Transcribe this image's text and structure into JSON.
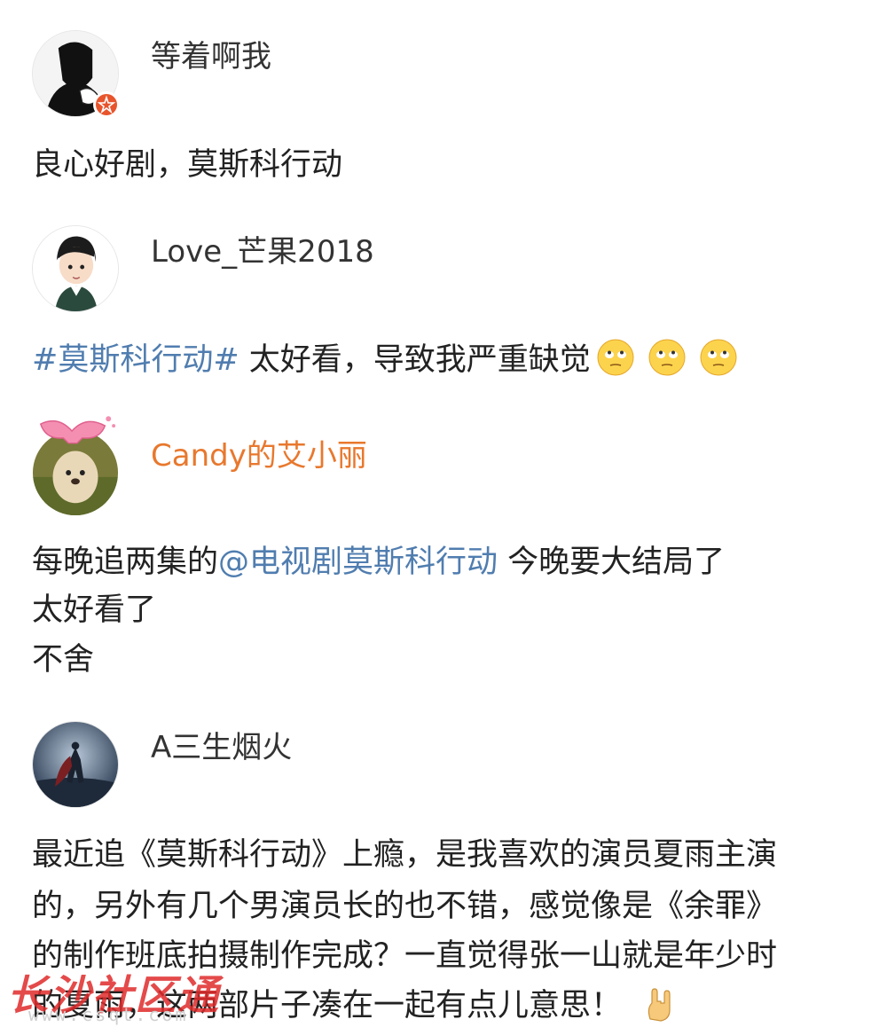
{
  "posts": [
    {
      "username": "等着啊我",
      "lines": [
        "良心好剧，莫斯科行动"
      ]
    },
    {
      "username": "Love_芒果2018",
      "hashtag": "#莫斯科行动#",
      "text": " 太好看，导致我严重缺觉",
      "emoji": "eye-roll-emoji"
    },
    {
      "username": "Candy的艾小丽",
      "line1_prefix": "每晚追两集的",
      "mention": "@电视剧莫斯科行动",
      "line1_suffix": " 今晚要大结局了",
      "line2": "太好看了",
      "line3": "不舍"
    },
    {
      "username": "A三生烟火",
      "lines": [
        "最近追《莫斯科行动》上瘾，是我喜欢的演员夏雨主演",
        "的，另外有几个男演员长的也不错，感觉像是《余罪》",
        "的制作班底拍摄制作完成？一直觉得张一山就是年少时",
        "的夏雨，这两部片子凑在一起有点儿意思！"
      ],
      "emoji": "rock-hand-emoji"
    }
  ],
  "watermark": {
    "text": "长沙社区通",
    "sub": "www.csqt.com"
  },
  "colors": {
    "link": "#507daf",
    "orange_username": "#e8782d",
    "watermark": "#e02b2b"
  }
}
